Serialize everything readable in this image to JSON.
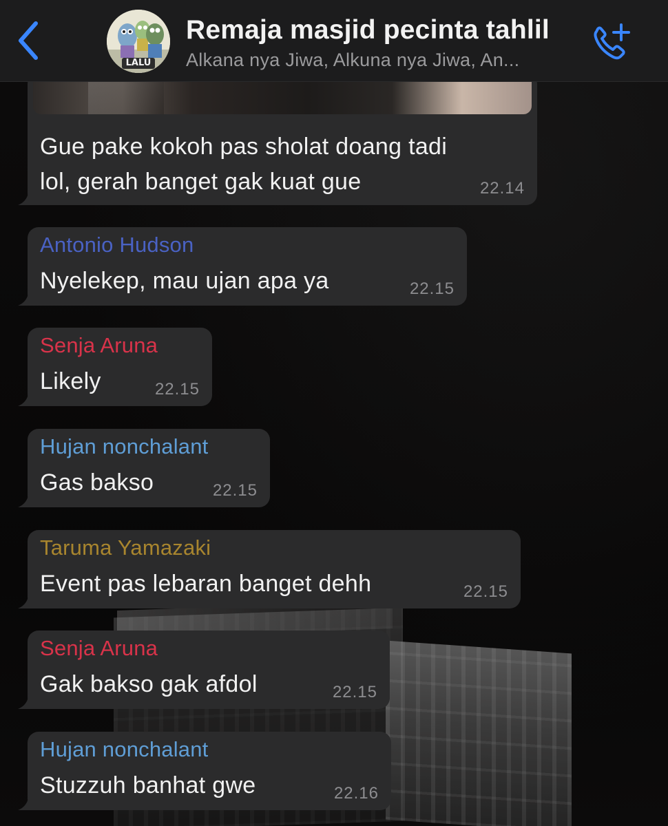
{
  "header": {
    "title": "Remaja masjid pecinta tahlil",
    "members": "Alkana nya Jiwa, Alkuna nya Jiwa, An...",
    "avatar_text": "LALU",
    "back_icon": "chevron-left-icon",
    "call_icon": "phone-plus-icon",
    "accent_color": "#3a86ff"
  },
  "messages": [
    {
      "sender": "",
      "lines": [
        "Gue pake kokoh pas sholat doang tadi",
        "lol, gerah banget gak kuat gue"
      ],
      "time": "22.14",
      "has_image": true
    },
    {
      "sender": "Antonio Hudson",
      "sender_color": "#4a62c4",
      "lines": [
        "Nyelekep, mau ujan apa ya"
      ],
      "time": "22.15"
    },
    {
      "sender": "Senja Aruna",
      "sender_color": "#d9334a",
      "lines": [
        "Likely"
      ],
      "time": "22.15"
    },
    {
      "sender": "Hujan nonchalant",
      "sender_color": "#5f9ed6",
      "lines": [
        "Gas bakso"
      ],
      "time": "22.15"
    },
    {
      "sender": "Taruma Yamazaki",
      "sender_color": "#a8852e",
      "lines": [
        "Event pas lebaran banget dehh"
      ],
      "time": "22.15"
    },
    {
      "sender": "Senja Aruna",
      "sender_color": "#d9334a",
      "lines": [
        "Gak bakso gak afdol"
      ],
      "time": "22.15"
    },
    {
      "sender": "Hujan nonchalant",
      "sender_color": "#5f9ed6",
      "lines": [
        "Stuzzuh banhat gwe"
      ],
      "time": "22.16"
    }
  ]
}
